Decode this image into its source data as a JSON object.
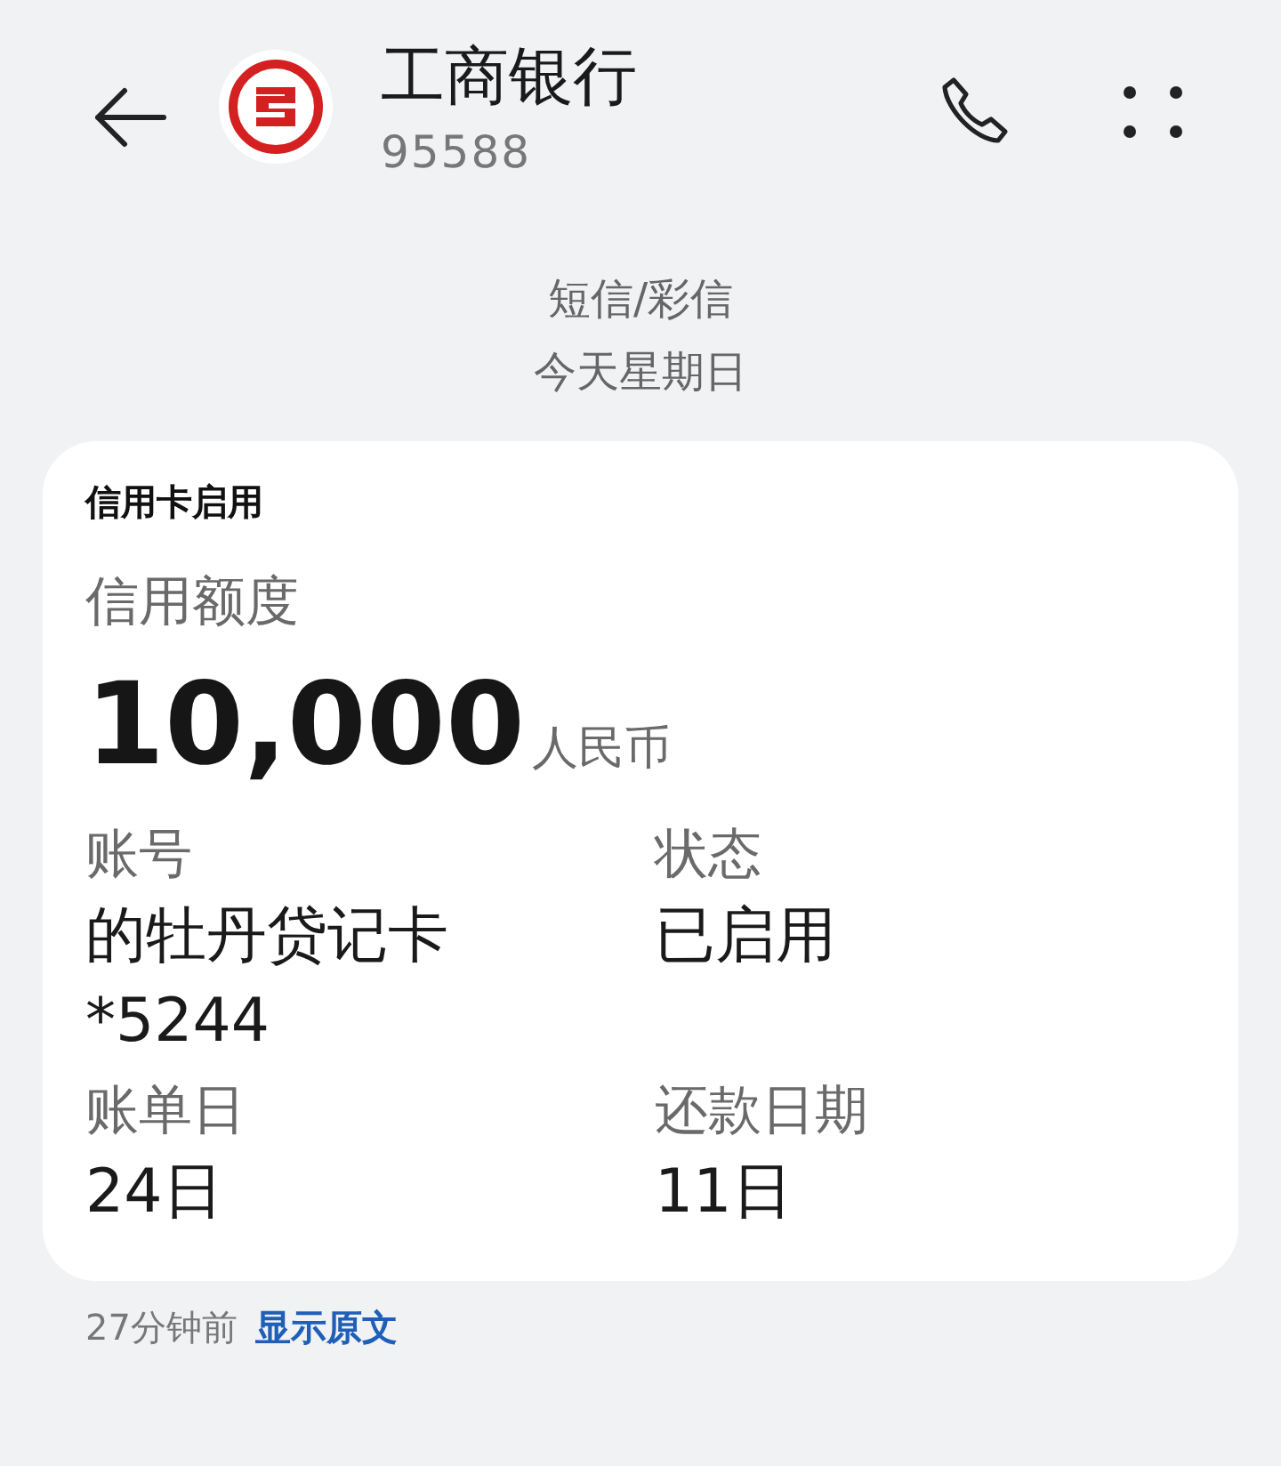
{
  "header": {
    "title": "工商银行",
    "number": "95588"
  },
  "meta": {
    "channel": "短信/彩信",
    "date": "今天星期日"
  },
  "card": {
    "title": "信用卡启用",
    "limit_label": "信用额度",
    "amount": "10,000",
    "currency": "人民币",
    "fields": [
      {
        "label": "账号",
        "values": [
          "的牡丹贷记卡",
          "*5244"
        ]
      },
      {
        "label": "状态",
        "values": [
          "已启用"
        ]
      },
      {
        "label": "账单日",
        "values": [
          "24日"
        ]
      },
      {
        "label": "还款日期",
        "values": [
          "11日"
        ]
      }
    ]
  },
  "footer": {
    "time": "27分钟前",
    "link": "显示原文"
  }
}
